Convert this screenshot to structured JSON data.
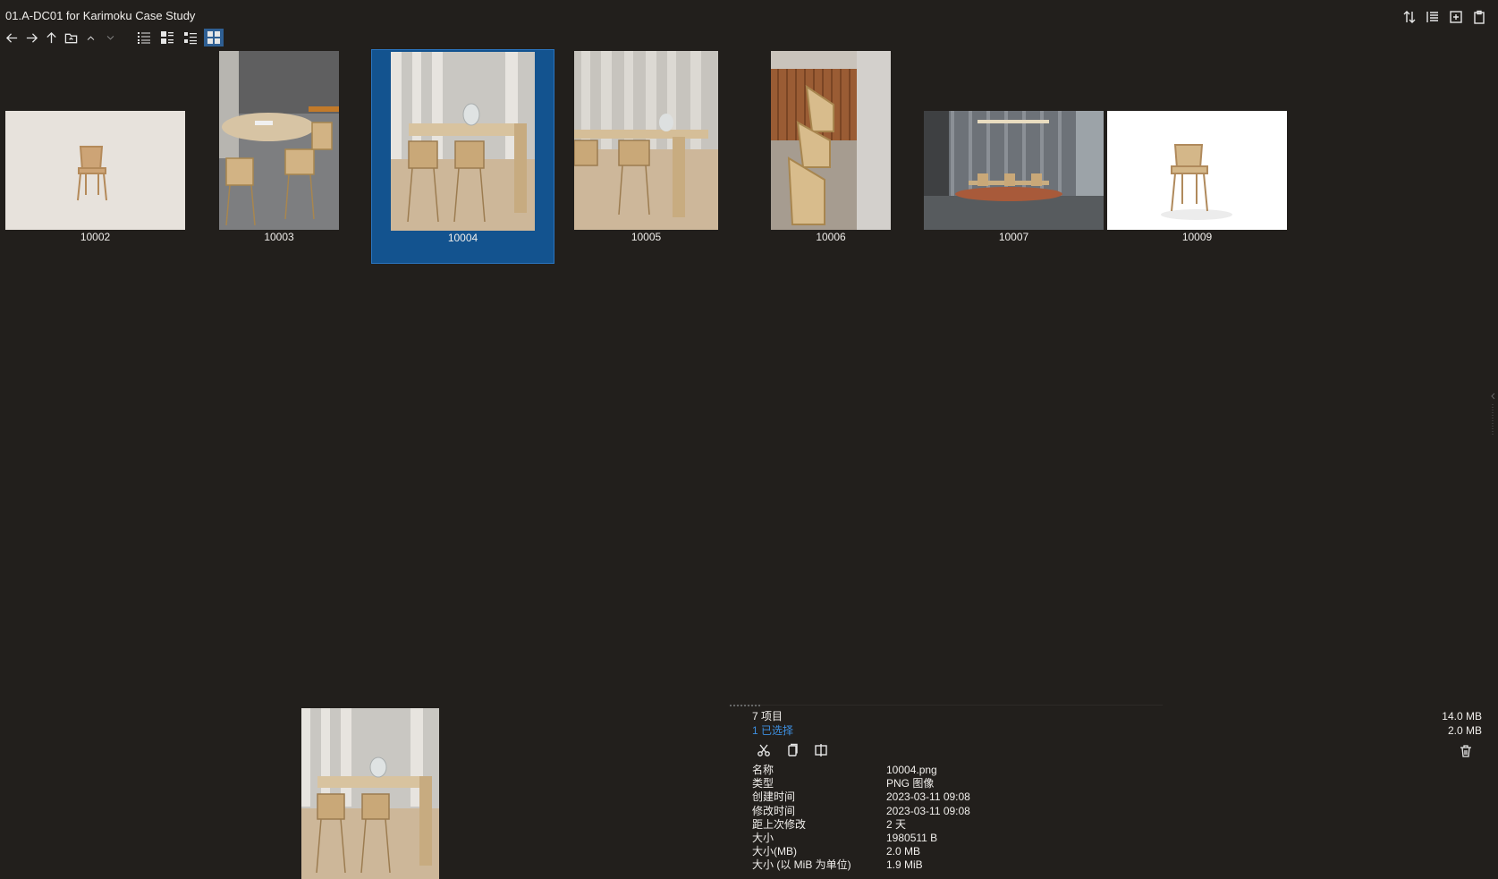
{
  "window": {
    "title": "01.A-DC01 for Karimoku Case Study"
  },
  "toolbar": {
    "nav": [
      "back-icon",
      "forward-icon",
      "up-icon",
      "folder-icon",
      "chevron-up-icon",
      "chevron-down-icon"
    ],
    "views": [
      "details-view-icon",
      "list-view-icon",
      "tiles-view-icon",
      "thumbnails-view-icon"
    ],
    "active_view": "thumbnails-view-icon",
    "right": [
      "sort-icon",
      "columns-icon",
      "new-pane-icon",
      "clipboard-icon"
    ]
  },
  "files": [
    {
      "name": "10002"
    },
    {
      "name": "10003"
    },
    {
      "name": "10004",
      "selected": true
    },
    {
      "name": "10005"
    },
    {
      "name": "10006"
    },
    {
      "name": "10007"
    },
    {
      "name": "10009"
    }
  ],
  "status": {
    "items": "7 项目",
    "selected": "1 已选择",
    "total_size": "14.0 MB",
    "selected_size": "2.0 MB"
  },
  "actions": [
    "cut-icon",
    "copy-icon",
    "compare-icon"
  ],
  "properties": [
    {
      "label": "名称",
      "value": "10004.png"
    },
    {
      "label": "类型",
      "value": "PNG 图像"
    },
    {
      "label": "创建时间",
      "value": "2023-03-11  09:08"
    },
    {
      "label": "修改时间",
      "value": "2023-03-11  09:08"
    },
    {
      "label": "距上次修改",
      "value": "2 天"
    },
    {
      "label": "大小",
      "value": "1980511 B"
    },
    {
      "label": "大小(MB)",
      "value": "2.0 MB"
    },
    {
      "label": "大小  (以 MiB 为单位)",
      "value": "1.9 MiB"
    }
  ],
  "colors": {
    "background": "#221f1c",
    "selection": "#13538f",
    "accent": "#3d8fe0"
  }
}
